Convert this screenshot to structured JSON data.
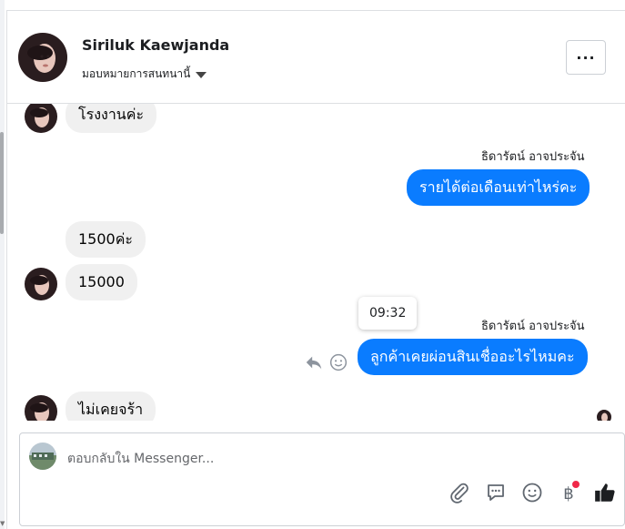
{
  "header": {
    "name": "Siriluk Kaewjanda",
    "assign_label": "มอบหมายการสนทนานี้",
    "more_label": "···"
  },
  "messages": [
    {
      "side": "in",
      "text": "โรงงานค่ะ"
    },
    {
      "side": "out",
      "sender": "ธิดารัตน์ อาจประจัน",
      "text": "รายได้ต่อเดือนเท่าไหร่คะ"
    },
    {
      "side": "in",
      "text": "1500ค่ะ"
    },
    {
      "side": "in",
      "text": "15000"
    },
    {
      "side": "out",
      "sender": "ธิดารัตน์ อาจประจัน",
      "text": "ลูกค้าเคยผ่อนสินเชื่ออะไรไหมคะ",
      "tooltip": "09:32"
    },
    {
      "side": "in",
      "text": "ไม่เคยจร้า"
    }
  ],
  "composer": {
    "placeholder": "ตอบกลับใน Messenger..."
  },
  "icons": {
    "attach": "paperclip-icon",
    "saved_replies": "chat-bubble-icon",
    "emoji": "smiley-icon",
    "payment": "baht-icon",
    "like": "thumbs-up-icon"
  },
  "colors": {
    "outgoing_bubble": "#0a7cff",
    "incoming_bubble": "#f0f0f0",
    "notification_dot": "#f02849"
  }
}
